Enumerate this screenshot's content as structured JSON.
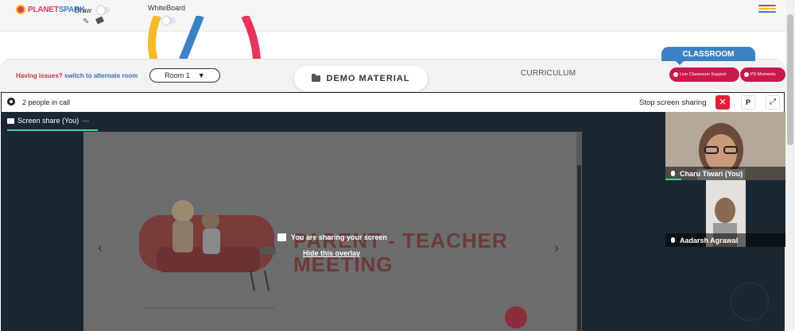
{
  "header": {
    "logo_text_1": "PLANET",
    "logo_text_2": "SPARK",
    "draw_label": "Draw",
    "whiteboard_label": "WhiteBoard"
  },
  "toolbar": {
    "issues_text": "Having issues?",
    "alt_room_link": "switch to alternate room",
    "room_selected": "Room 1",
    "demo_material": "DEMO MATERIAL",
    "curriculum_tab": "CURRICULUM",
    "classroom_tab": "CLASSROOM",
    "live_support": "Live Classroom Support",
    "ps_moments": "PS Moments"
  },
  "call": {
    "people_count": "2 people in call",
    "stop_sharing": "Stop screen sharing",
    "stop_glyph": "✕",
    "p_button": "P",
    "expand_glyph": "⤢"
  },
  "screen_share": {
    "tab_label": "Screen share (You)",
    "tab_more": "···",
    "slide_title_line1": "PARENT - TEACHER",
    "slide_title_line2": "MEETING",
    "overlay_message": "You are sharing your screen",
    "hide_overlay": "Hide this overlay",
    "prev_glyph": "‹",
    "next_glyph": "›"
  },
  "participants": [
    {
      "name": "Charu Tiwari (You)"
    },
    {
      "name": "Aadarsh Agrawal"
    }
  ],
  "colors": {
    "brand_red": "#e8335e",
    "brand_blue": "#3b82c4",
    "accent_green": "#3fd5a0",
    "stop_red": "#e21f36",
    "pill_magenta": "#c9184a",
    "video_bg": "#1b2833"
  },
  "icons": [
    "gear-icon",
    "monitor-icon",
    "pen-icon",
    "eraser-icon",
    "folder-icon",
    "mic-icon",
    "hamburger-icon",
    "share-screen-icon"
  ]
}
